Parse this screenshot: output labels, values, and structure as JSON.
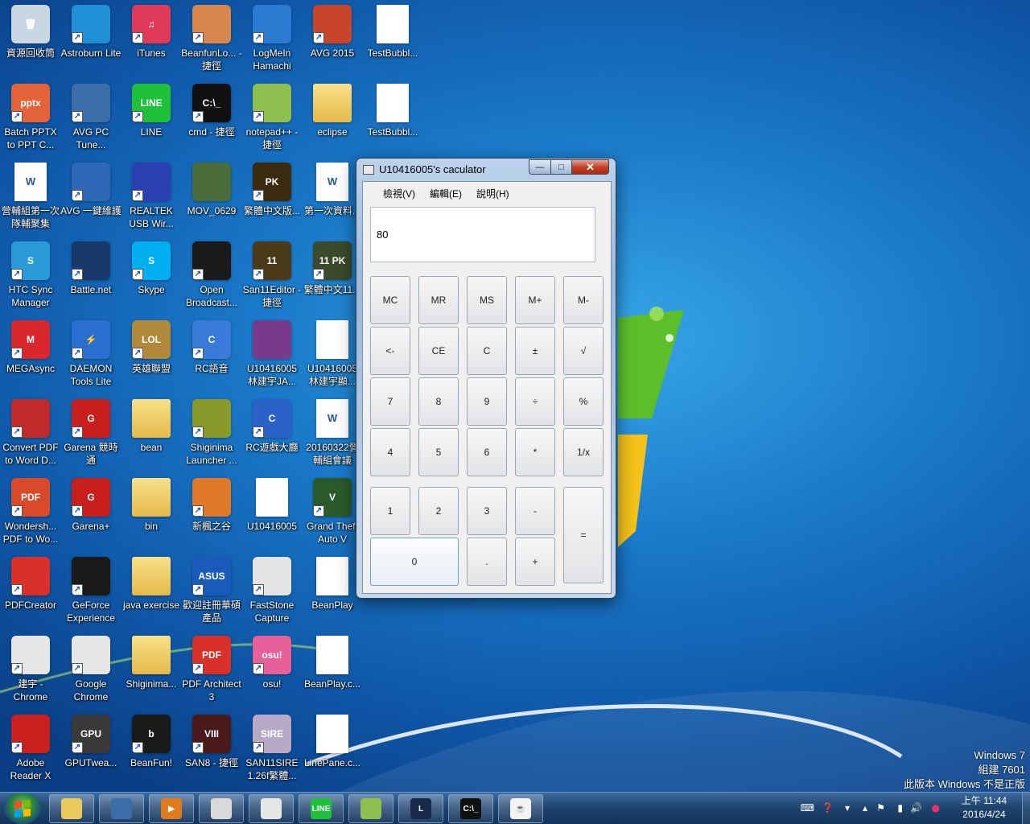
{
  "desktop": {
    "icons": [
      {
        "label": "資源回收筒",
        "icon": "recycle-bin-icon",
        "color": "#c9d6e3",
        "glyph": "🗑",
        "kind": "app",
        "shortcut": false
      },
      {
        "label": "Astroburn Lite",
        "icon": "astroburn-icon",
        "color": "#1f8fd6",
        "glyph": "",
        "kind": "app",
        "shortcut": true
      },
      {
        "label": "iTunes",
        "icon": "itunes-icon",
        "color": "#e03a5a",
        "glyph": "♫",
        "kind": "app",
        "shortcut": true
      },
      {
        "label": "BeanfunLo... - 捷徑",
        "icon": "beanfun-launcher-icon",
        "color": "#d8874c",
        "glyph": "",
        "kind": "app",
        "shortcut": true
      },
      {
        "label": "LogMeIn Hamachi",
        "icon": "hamachi-icon",
        "color": "#2b7bd0",
        "glyph": "",
        "kind": "app",
        "shortcut": true
      },
      {
        "label": "AVG 2015",
        "icon": "avg-icon",
        "color": "#c8442a",
        "glyph": "",
        "kind": "app",
        "shortcut": true
      },
      {
        "label": "TestBubbl...",
        "icon": "document-icon",
        "color": "#ffffff",
        "glyph": "",
        "kind": "doc",
        "shortcut": false
      },
      {
        "label": "Batch PPTX to PPT C...",
        "icon": "batch-pptx-icon",
        "color": "#e4643a",
        "glyph": "pptx",
        "kind": "app",
        "shortcut": true
      },
      {
        "label": "AVG PC Tune...",
        "icon": "avg-pc-tuneup-icon",
        "color": "#3b6ea8",
        "glyph": "",
        "kind": "app",
        "shortcut": true
      },
      {
        "label": "LINE",
        "icon": "line-icon",
        "color": "#1fc13b",
        "glyph": "LINE",
        "kind": "app",
        "shortcut": true
      },
      {
        "label": "cmd - 捷徑",
        "icon": "cmd-icon",
        "color": "#111111",
        "glyph": "C:\\_",
        "kind": "app",
        "shortcut": true
      },
      {
        "label": "notepad++ - 捷徑",
        "icon": "notepad-plus-plus-icon",
        "color": "#8fbf4f",
        "glyph": "",
        "kind": "app",
        "shortcut": true
      },
      {
        "label": "eclipse",
        "icon": "folder-icon",
        "color": "#e9c95e",
        "glyph": "",
        "kind": "folder",
        "shortcut": false
      },
      {
        "label": "TestBubbl...",
        "icon": "document-icon",
        "color": "#ffffff",
        "glyph": "",
        "kind": "doc",
        "shortcut": false
      },
      {
        "label": "營輔組第一次隊輔聚集",
        "icon": "word-document-icon",
        "color": "#ffffff",
        "glyph": "W",
        "kind": "doc",
        "shortcut": false
      },
      {
        "label": "AVG 一鍵維護",
        "icon": "avg-one-click-icon",
        "color": "#2f68b7",
        "glyph": "",
        "kind": "app",
        "shortcut": true
      },
      {
        "label": "REALTEK USB Wir...",
        "icon": "realtek-usb-icon",
        "color": "#2a3fb0",
        "glyph": "",
        "kind": "app",
        "shortcut": true
      },
      {
        "label": "MOV_0629",
        "icon": "video-file-icon",
        "color": "#4a6b3a",
        "glyph": "",
        "kind": "app",
        "shortcut": false
      },
      {
        "label": "繁體中文版...",
        "icon": "san-game-icon",
        "color": "#3a2a10",
        "glyph": "PK",
        "kind": "app",
        "shortcut": true
      },
      {
        "label": "第一次資料...",
        "icon": "word-document-icon",
        "color": "#ffffff",
        "glyph": "W",
        "kind": "doc",
        "shortcut": false
      },
      {
        "label": "HTC Sync Manager",
        "icon": "htc-sync-icon",
        "color": "#2a9ad9",
        "glyph": "S",
        "kind": "app",
        "shortcut": true
      },
      {
        "label": "Battle.net",
        "icon": "battlenet-icon",
        "color": "#173a6a",
        "glyph": "",
        "kind": "app",
        "shortcut": true
      },
      {
        "label": "Skype",
        "icon": "skype-icon",
        "color": "#00aff0",
        "glyph": "S",
        "kind": "app",
        "shortcut": true
      },
      {
        "label": "Open Broadcast...",
        "icon": "obs-icon",
        "color": "#1a1a1a",
        "glyph": "",
        "kind": "app",
        "shortcut": true
      },
      {
        "label": "San11Editor - 捷徑",
        "icon": "san11-editor-icon",
        "color": "#4a3a1a",
        "glyph": "11",
        "kind": "app",
        "shortcut": true
      },
      {
        "label": "繁體中文11...",
        "icon": "san11-pk-icon",
        "color": "#3a4a2a",
        "glyph": "11 PK",
        "kind": "app",
        "shortcut": true
      },
      {
        "label": "MEGAsync",
        "icon": "megasync-icon",
        "color": "#d9272e",
        "glyph": "M",
        "kind": "app",
        "shortcut": true
      },
      {
        "label": "DAEMON Tools Lite",
        "icon": "daemon-tools-icon",
        "color": "#2a6ed0",
        "glyph": "⚡",
        "kind": "app",
        "shortcut": true
      },
      {
        "label": "英雄聯盟",
        "icon": "league-of-legends-icon",
        "color": "#b08a3a",
        "glyph": "LOL",
        "kind": "app",
        "shortcut": true
      },
      {
        "label": "RC語音",
        "icon": "rc-voice-icon",
        "color": "#3a7ad9",
        "glyph": "C",
        "kind": "app",
        "shortcut": true
      },
      {
        "label": "U10416005 林建宇JA...",
        "icon": "winrar-icon",
        "color": "#7a3a8a",
        "glyph": "",
        "kind": "app",
        "shortcut": false
      },
      {
        "label": "U10416005 林建宇顯...",
        "icon": "document-icon",
        "color": "#ffffff",
        "glyph": "",
        "kind": "doc",
        "shortcut": false
      },
      {
        "label": "Convert PDF to Word D...",
        "icon": "convert-pdf-icon",
        "color": "#c02a2a",
        "glyph": "",
        "kind": "app",
        "shortcut": true
      },
      {
        "label": "Garena 競時通",
        "icon": "garena-talk-icon",
        "color": "#c81e1e",
        "glyph": "G",
        "kind": "app",
        "shortcut": true
      },
      {
        "label": "bean",
        "icon": "folder-icon",
        "color": "#e9c95e",
        "glyph": "",
        "kind": "folder",
        "shortcut": false
      },
      {
        "label": "Shiginima Launcher ...",
        "icon": "shiginima-launcher-icon",
        "color": "#8a9a2a",
        "glyph": "",
        "kind": "app",
        "shortcut": true
      },
      {
        "label": "RC遊戲大廳",
        "icon": "rc-game-hall-icon",
        "color": "#2a62c8",
        "glyph": "C",
        "kind": "app",
        "shortcut": true
      },
      {
        "label": "20160322營輔組會議",
        "icon": "word-document-icon",
        "color": "#ffffff",
        "glyph": "W",
        "kind": "doc",
        "shortcut": false
      },
      {
        "label": "Wondersh... PDF to Wo...",
        "icon": "wondershare-pdf-icon",
        "color": "#d94a2a",
        "glyph": "PDF",
        "kind": "app",
        "shortcut": true
      },
      {
        "label": "Garena+",
        "icon": "garena-plus-icon",
        "color": "#c81e1e",
        "glyph": "G",
        "kind": "app",
        "shortcut": true
      },
      {
        "label": "bin",
        "icon": "folder-icon",
        "color": "#e9c95e",
        "glyph": "",
        "kind": "folder",
        "shortcut": false
      },
      {
        "label": "新楓之谷",
        "icon": "maplestory-icon",
        "color": "#e07a2a",
        "glyph": "",
        "kind": "app",
        "shortcut": true
      },
      {
        "label": "U10416005",
        "icon": "pdf-document-icon",
        "color": "#ffffff",
        "glyph": "",
        "kind": "doc",
        "shortcut": false
      },
      {
        "label": "Grand Theft Auto V",
        "icon": "gta-v-icon",
        "color": "#2a5a2a",
        "glyph": "V",
        "kind": "app",
        "shortcut": true
      },
      {
        "label": "PDFCreator",
        "icon": "pdfcreator-icon",
        "color": "#d9302a",
        "glyph": "",
        "kind": "app",
        "shortcut": true
      },
      {
        "label": "GeForce Experience",
        "icon": "geforce-icon",
        "color": "#1a1a1a",
        "glyph": "",
        "kind": "app",
        "shortcut": true
      },
      {
        "label": "java exercise",
        "icon": "folder-icon",
        "color": "#e9c95e",
        "glyph": "",
        "kind": "folder",
        "shortcut": false
      },
      {
        "label": "歡迎註冊華碩產品",
        "icon": "asus-icon",
        "color": "#1a5ab8",
        "glyph": "ASUS",
        "kind": "app",
        "shortcut": true
      },
      {
        "label": "FastStone Capture",
        "icon": "faststone-capture-icon",
        "color": "#e4e4e4",
        "glyph": "",
        "kind": "app",
        "shortcut": true
      },
      {
        "label": "BeanPlay",
        "icon": "document-icon",
        "color": "#ffffff",
        "glyph": "",
        "kind": "doc",
        "shortcut": false
      },
      {
        "label": "建宇 - Chrome",
        "icon": "chrome-icon",
        "color": "#e6e6e6",
        "glyph": "",
        "kind": "app",
        "shortcut": true
      },
      {
        "label": "Google Chrome",
        "icon": "chrome-icon",
        "color": "#e6e6e6",
        "glyph": "",
        "kind": "app",
        "shortcut": true
      },
      {
        "label": "Shiginima...",
        "icon": "folder-icon",
        "color": "#e9c95e",
        "glyph": "",
        "kind": "folder",
        "shortcut": false
      },
      {
        "label": "PDF Architect 3",
        "icon": "pdf-architect-icon",
        "color": "#d9302a",
        "glyph": "PDF",
        "kind": "app",
        "shortcut": true
      },
      {
        "label": "osu!",
        "icon": "osu-icon",
        "color": "#e8609a",
        "glyph": "osu!",
        "kind": "app",
        "shortcut": true
      },
      {
        "label": "BeanPlay.c...",
        "icon": "document-icon",
        "color": "#ffffff",
        "glyph": "",
        "kind": "doc",
        "shortcut": false
      },
      {
        "label": "Adobe Reader X",
        "icon": "adobe-reader-icon",
        "color": "#c8201e",
        "glyph": "",
        "kind": "app",
        "shortcut": true
      },
      {
        "label": "GPUTwea...",
        "icon": "gputweak-icon",
        "color": "#3a3a3a",
        "glyph": "GPU",
        "kind": "app",
        "shortcut": true
      },
      {
        "label": "BeanFun!",
        "icon": "beanfun-icon",
        "color": "#1a1a1a",
        "glyph": "b",
        "kind": "app",
        "shortcut": true
      },
      {
        "label": "SAN8 - 捷徑",
        "icon": "san8-icon",
        "color": "#4a1a1a",
        "glyph": "VIII",
        "kind": "app",
        "shortcut": true
      },
      {
        "label": "SAN11SIRE 1.26f繁體...",
        "icon": "san11sire-icon",
        "color": "#b8a8c8",
        "glyph": "SIRE",
        "kind": "app",
        "shortcut": true
      },
      {
        "label": "LinePane.c...",
        "icon": "document-icon",
        "color": "#ffffff",
        "glyph": "",
        "kind": "doc",
        "shortcut": false
      }
    ]
  },
  "calculator": {
    "title": "U10416005's caculator",
    "window_controls": {
      "minimize": "—",
      "maximize": "□",
      "close": "✕"
    },
    "menu": [
      "檢視(V)",
      "編輯(E)",
      "說明(H)"
    ],
    "display_value": "80",
    "keys": {
      "mc": "MC",
      "mr": "MR",
      "ms": "MS",
      "mplus": "M+",
      "mminus": "M-",
      "back": "<-",
      "ce": "CE",
      "c": "C",
      "pm": "±",
      "sqrt": "√",
      "k7": "7",
      "k8": "8",
      "k9": "9",
      "div": "÷",
      "pct": "%",
      "k4": "4",
      "k5": "5",
      "k6": "6",
      "mul": "*",
      "recip": "1/x",
      "k1": "1",
      "k2": "2",
      "k3": "3",
      "sub": "-",
      "eq": "=",
      "k0": "0",
      "dot": ".",
      "add": "+"
    }
  },
  "taskbar": {
    "pinned": [
      {
        "name": "explorer",
        "icon": "folder-icon",
        "color": "#e9c95e",
        "glyph": ""
      },
      {
        "name": "avg",
        "icon": "avg-pc-tuneup-icon",
        "color": "#3b6ea8",
        "glyph": ""
      },
      {
        "name": "media-player",
        "icon": "media-player-icon",
        "color": "#e07a1e",
        "glyph": "▶"
      },
      {
        "name": "faststone",
        "icon": "faststone-capture-icon",
        "color": "#d9d9d9",
        "glyph": ""
      },
      {
        "name": "chrome",
        "icon": "chrome-icon",
        "color": "#e6e6e6",
        "glyph": ""
      },
      {
        "name": "line",
        "icon": "line-icon",
        "color": "#1fc13b",
        "glyph": "LINE"
      },
      {
        "name": "notepad++",
        "icon": "notepad-plus-plus-icon",
        "color": "#8fbf4f",
        "glyph": ""
      },
      {
        "name": "league",
        "icon": "league-of-legends-icon",
        "color": "#1a2a4a",
        "glyph": "L"
      },
      {
        "name": "cmd",
        "icon": "cmd-icon",
        "color": "#111111",
        "glyph": "C:\\_"
      },
      {
        "name": "java",
        "icon": "java-icon",
        "color": "#f3f3f3",
        "glyph": "☕"
      }
    ],
    "clock_time": "上午 11:44",
    "clock_date": "2016/4/24"
  },
  "watermark": {
    "line1": "Windows 7",
    "line2": "組建 7601",
    "line3": "此版本 Windows 不是正版"
  }
}
